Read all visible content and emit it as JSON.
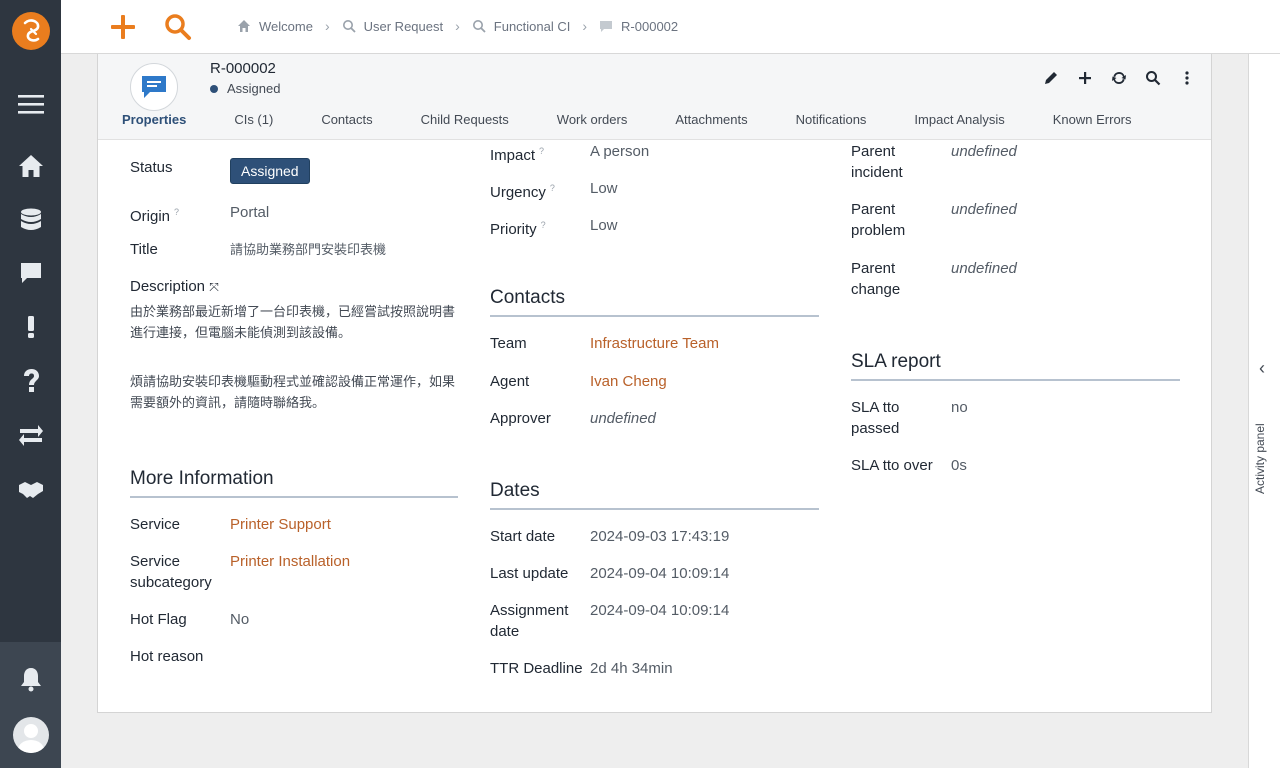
{
  "breadcrumb": [
    {
      "label": "Welcome",
      "icon": "home-icon"
    },
    {
      "label": "User Request",
      "icon": "search-icon"
    },
    {
      "label": "Functional CI",
      "icon": "search-icon"
    },
    {
      "label": "R-000002",
      "icon": "ticket-icon"
    }
  ],
  "object": {
    "ref": "R-000002",
    "status": "Assigned"
  },
  "tabs": [
    "Properties",
    "CIs (1)",
    "Contacts",
    "Child Requests",
    "Work orders",
    "Attachments",
    "Notifications",
    "Impact Analysis",
    "Known Errors"
  ],
  "left": {
    "status_label": "Status",
    "status_value": "Assigned",
    "origin_label": "Origin",
    "origin_value": "Portal",
    "title_label": "Title",
    "title_value": "請協助業務部門安裝印表機",
    "description_label": "Description",
    "description_p1": "由於業務部最近新增了一台印表機，已經嘗試按照說明書進行連接，但電腦未能偵測到該設備。",
    "description_p2": "煩請協助安裝印表機驅動程式並確認設備正常運作，如果需要額外的資訊，請隨時聯絡我。",
    "more_info_title": "More Information",
    "service_label": "Service",
    "service_value": "Printer Support",
    "subcategory_label_1": "Service",
    "subcategory_label_2": "subcategory",
    "subcategory_value": "Printer Installation",
    "hotflag_label": "Hot Flag",
    "hotflag_value": "No",
    "hotreason_label": "Hot reason"
  },
  "middle": {
    "impact_label": "Impact",
    "impact_value": "A person",
    "urgency_label": "Urgency",
    "urgency_value": "Low",
    "priority_label": "Priority",
    "priority_value": "Low",
    "contacts_title": "Contacts",
    "team_label": "Team",
    "team_value": "Infrastructure Team",
    "agent_label": "Agent",
    "agent_value": "Ivan Cheng",
    "approver_label": "Approver",
    "approver_value": "undefined",
    "dates_title": "Dates",
    "start_label": "Start date",
    "start_value": "2024-09-03 17:43:19",
    "update_label": "Last update",
    "update_value": "2024-09-04 10:09:14",
    "assign_label_1": "Assignment",
    "assign_label_2": "date",
    "assign_value": "2024-09-04 10:09:14",
    "ttr_label": "TTR Deadline",
    "ttr_value": "2d 4h 34min"
  },
  "right": {
    "pinc_label_1": "Parent",
    "pinc_label_2": "incident",
    "pinc_value": "undefined",
    "pprob_label_1": "Parent",
    "pprob_label_2": "problem",
    "pprob_value": "undefined",
    "pchg_label_1": "Parent",
    "pchg_label_2": "change",
    "pchg_value": "undefined",
    "sla_title": "SLA report",
    "tto_passed_label_1": "SLA tto",
    "tto_passed_label_2": "passed",
    "tto_passed_value": "no",
    "tto_over_label": "SLA tto over",
    "tto_over_value": "0s"
  },
  "activity_panel": "Activity panel",
  "colors": {
    "accent": "#ea7d1e",
    "link": "#b9612a",
    "status_badge": "#2e5078",
    "sidebar": "#2e3640"
  }
}
